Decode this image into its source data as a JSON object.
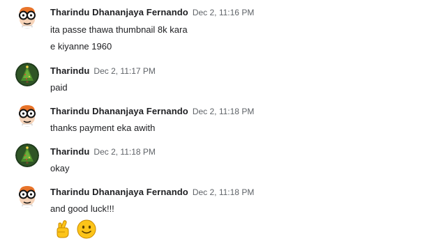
{
  "messages": [
    {
      "sender": "Tharindu Dhananjaya Fernando",
      "time": "Dec 2, 11:16 PM",
      "avatar": "dexter-avatar",
      "lines": [
        "ita passe thawa thumbnail 8k kara",
        "e kiyanne 1960"
      ]
    },
    {
      "sender": "Tharindu",
      "time": "Dec 2, 11:17 PM",
      "avatar": "christmas-tree-avatar",
      "lines": [
        "paid"
      ]
    },
    {
      "sender": "Tharindu Dhananjaya Fernando",
      "time": "Dec 2, 11:18 PM",
      "avatar": "dexter-avatar",
      "lines": [
        "thanks payment eka awith"
      ]
    },
    {
      "sender": "Tharindu",
      "time": "Dec 2, 11:18 PM",
      "avatar": "christmas-tree-avatar",
      "lines": [
        "okay"
      ]
    },
    {
      "sender": "Tharindu Dhananjaya Fernando",
      "time": "Dec 2, 11:18 PM",
      "avatar": "dexter-avatar",
      "lines": [
        "and good luck!!!"
      ],
      "emojis": [
        "crossed-fingers-emoji",
        "slightly-smiling-face-emoji"
      ]
    }
  ],
  "colors": {
    "sender": "#202124",
    "timestamp": "#5f6368",
    "message_text": "#202124",
    "background": "#ffffff"
  }
}
